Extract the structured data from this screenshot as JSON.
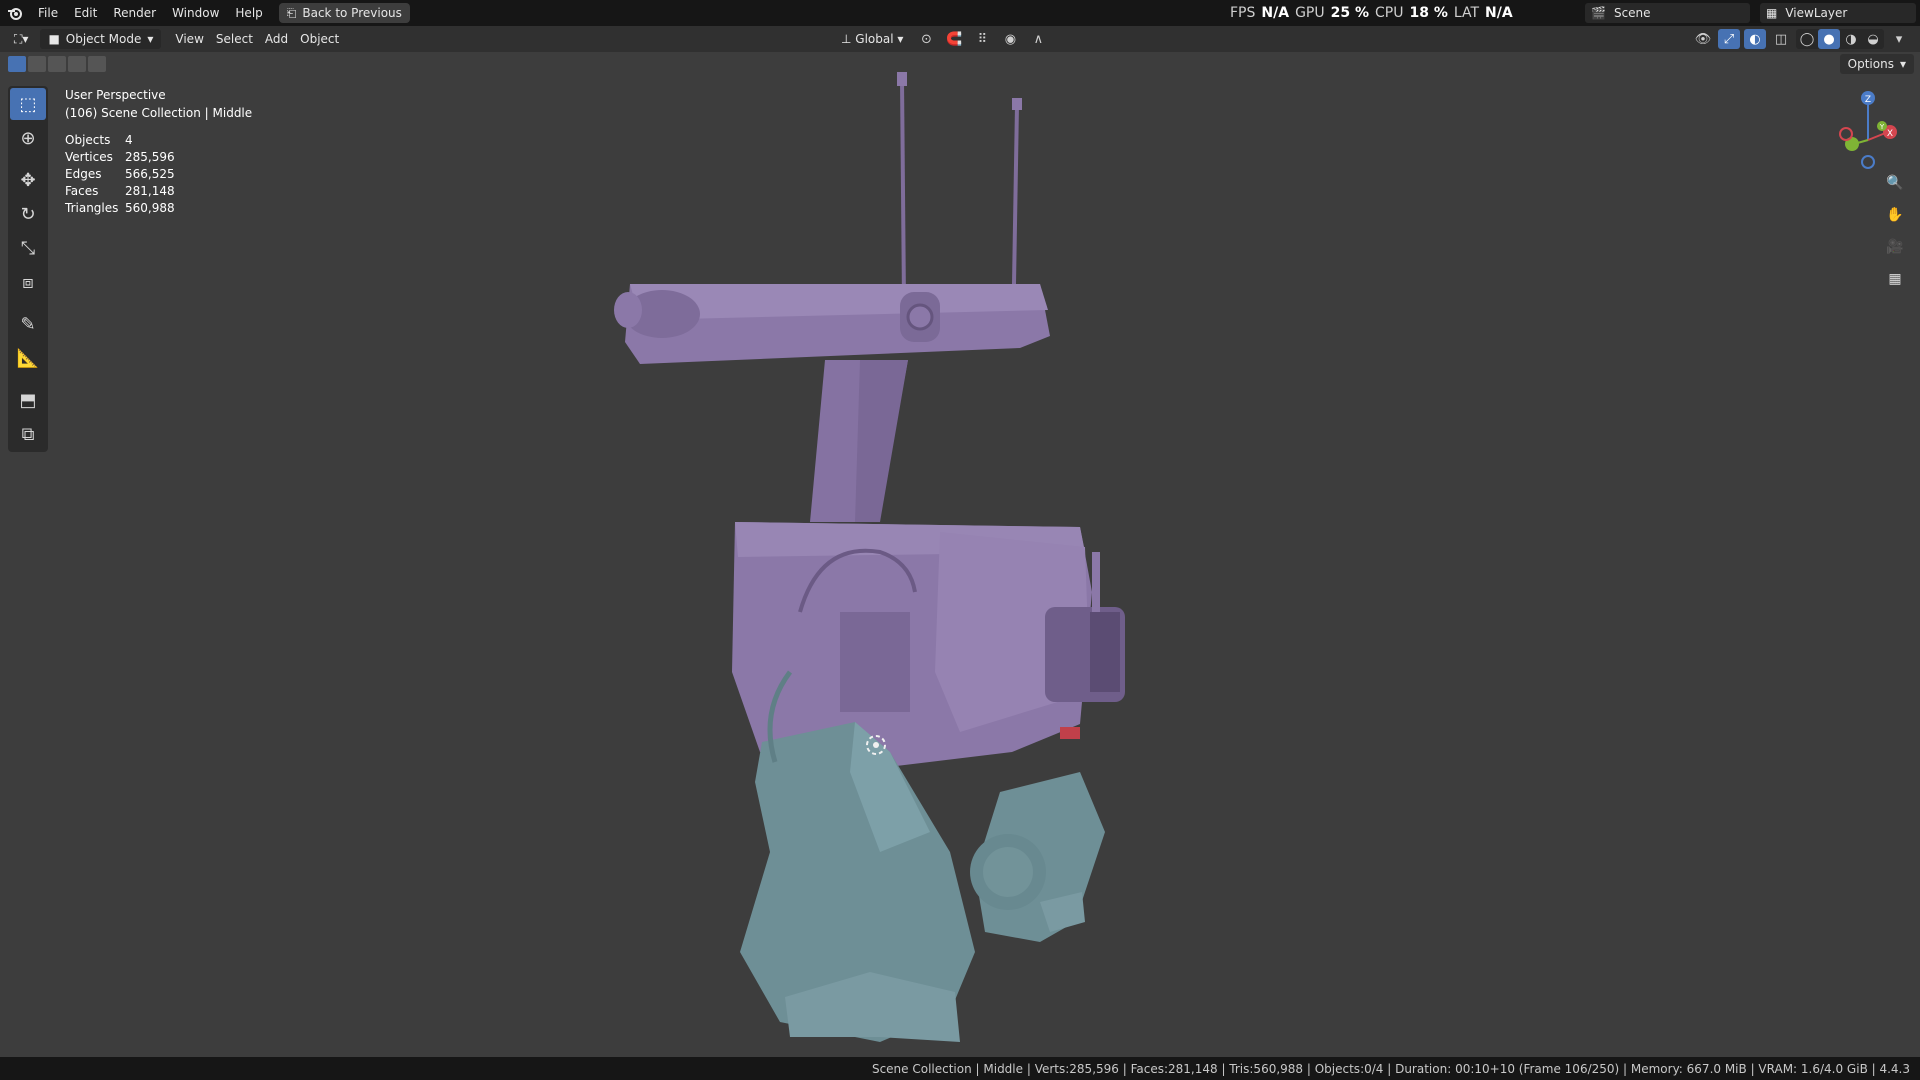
{
  "menubar": {
    "items": [
      "File",
      "Edit",
      "Render",
      "Window",
      "Help"
    ],
    "back_button": "Back to Previous"
  },
  "perf": {
    "fps_label": "FPS",
    "fps": "N/A",
    "gpu_label": "GPU",
    "gpu": "25 %",
    "cpu_label": "CPU",
    "cpu": "18 %",
    "lat_label": "LAT",
    "lat": "N/A"
  },
  "scene": {
    "name": "Scene",
    "view_layer": "ViewLayer"
  },
  "header": {
    "mode": "Object Mode",
    "menus": [
      "View",
      "Select",
      "Add",
      "Object"
    ],
    "orientation": "Global"
  },
  "viewport": {
    "options_label": "Options",
    "perspective": "User Perspective",
    "collection": "(106) Scene Collection | Middle",
    "stats": [
      {
        "label": "Objects",
        "value": "4"
      },
      {
        "label": "Vertices",
        "value": "285,596"
      },
      {
        "label": "Edges",
        "value": "566,525"
      },
      {
        "label": "Faces",
        "value": "281,148"
      },
      {
        "label": "Triangles",
        "value": "560,988"
      }
    ],
    "gizmo": {
      "z": "Z",
      "y": "Y",
      "x": "X"
    }
  },
  "statusbar": {
    "text": "Scene Collection | Middle | Verts:285,596 | Faces:281,148 | Tris:560,988 | Objects:0/4 | Duration: 00:10+10 (Frame 106/250) | Memory: 667.0 MiB | VRAM: 1.6/4.0 GiB | 4.4.3"
  },
  "colors": {
    "body": "#8b78a8",
    "legs": "#6e8f96",
    "accent": "#4772b3"
  },
  "icons": {
    "toolbar": [
      "select-box-icon",
      "cursor-icon",
      "move-icon",
      "rotate-icon",
      "scale-icon",
      "transform-icon",
      "annotate-icon",
      "measure-icon",
      "add-cube-icon",
      "extrude-icon"
    ],
    "nav": [
      "zoom-icon",
      "pan-icon",
      "camera-icon",
      "grid-icon"
    ]
  }
}
